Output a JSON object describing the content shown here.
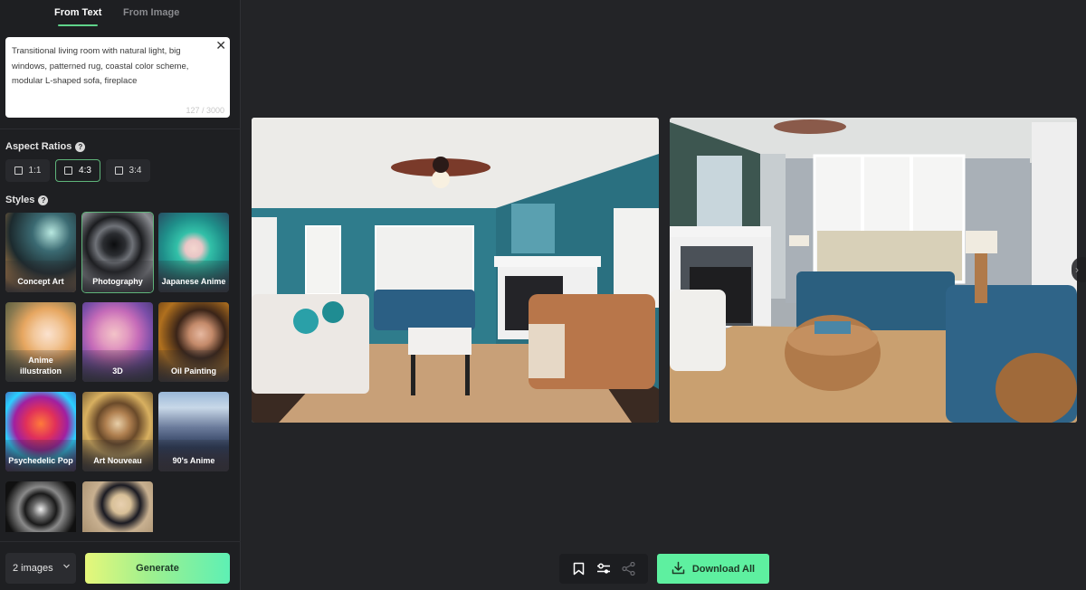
{
  "sidebar": {
    "tabs": [
      {
        "label": "From Text",
        "active": true
      },
      {
        "label": "From Image",
        "active": false
      }
    ],
    "prompt": {
      "value": "Transitional living room with natural light, big windows, patterned rug, coastal color scheme, modular L-shaped sofa, fireplace",
      "char_count": "127 / 3000",
      "clear_icon": "close-icon"
    },
    "aspect_ratios": {
      "label": "Aspect Ratios",
      "help_icon": "?",
      "options": [
        {
          "label": "1:1",
          "selected": false
        },
        {
          "label": "4:3",
          "selected": true
        },
        {
          "label": "3:4",
          "selected": false
        }
      ]
    },
    "styles": {
      "label": "Styles",
      "help_icon": "?",
      "items": [
        {
          "label": "Concept Art",
          "selected": false
        },
        {
          "label": "Photography",
          "selected": true
        },
        {
          "label": "Japanese Anime",
          "selected": false
        },
        {
          "label": "Anime illustration",
          "selected": false
        },
        {
          "label": "3D",
          "selected": false
        },
        {
          "label": "Oil Painting",
          "selected": false
        },
        {
          "label": "Psychedelic Pop",
          "selected": false
        },
        {
          "label": "Art Nouveau",
          "selected": false
        },
        {
          "label": "90's Anime",
          "selected": false
        },
        {
          "label": "",
          "selected": false
        },
        {
          "label": "",
          "selected": false
        }
      ]
    },
    "image_count": {
      "value": "2 images",
      "chevron": "⌄"
    },
    "generate_label": "Generate"
  },
  "main": {
    "images": [
      {
        "description": "Teal-walled living room with white sofa, blue loveseat, ceiling fan, fireplace, chevron armchair"
      },
      {
        "description": "Grey-walled living room with blue sectional sofa, woven ottoman, large windows, fireplace"
      }
    ],
    "carousel_next_icon": "›",
    "toolbar": {
      "icons": [
        "bookmark-icon",
        "sliders-icon",
        "share-icon"
      ]
    },
    "download_all_label": "Download All"
  },
  "colors": {
    "accent_green": "#5ef0a0",
    "selected_border": "#5fb47a",
    "background": "#232427",
    "sidebar_bg": "#1e1f22"
  }
}
